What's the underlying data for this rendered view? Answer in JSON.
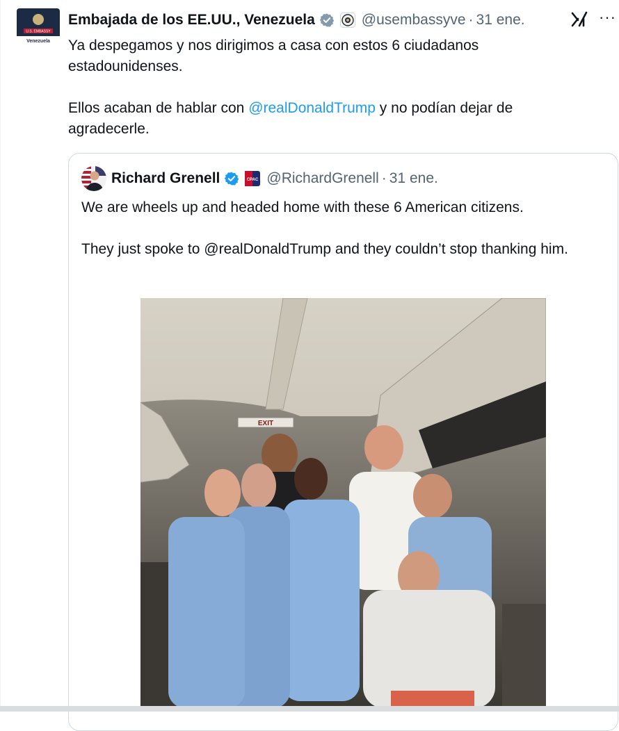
{
  "tweet": {
    "author_name": "Embajada de los EE.UU., Venezuela",
    "handle": "@usembassyve",
    "separator": "·",
    "time": "31 ene.",
    "more": "···",
    "avatar_text_top": "U.S. EMBASSY",
    "avatar_text_bottom": "Venezuela",
    "line1": "Ya despegamos y nos dirigimos a casa con estos 6 ciudadanos estadounidenses.",
    "line2_pre": "Ellos acaban de hablar con ",
    "line2_mention": "@realDonaldTrump",
    "line2_post": " y no podían dejar de agradecerle."
  },
  "quote": {
    "author_name": "Richard Grenell",
    "handle": "@RichardGrenell",
    "separator": "·",
    "time": "31 ene.",
    "badge_text": "CPAC",
    "line1": "We are wheels up and headed home with these 6 American citizens.",
    "line2": "They just spoke to @realDonaldTrump and they couldn’t stop thanking him.",
    "photo_exit_sign": "EXIT"
  },
  "icons": {
    "verified": "verified-badge-icon",
    "affiliation": "us-seal-icon",
    "grok": "grok-icon",
    "more": "more-icon"
  },
  "colors": {
    "link": "#1d9bf0",
    "verified": "#1d9bf0",
    "muted": "#536471"
  }
}
